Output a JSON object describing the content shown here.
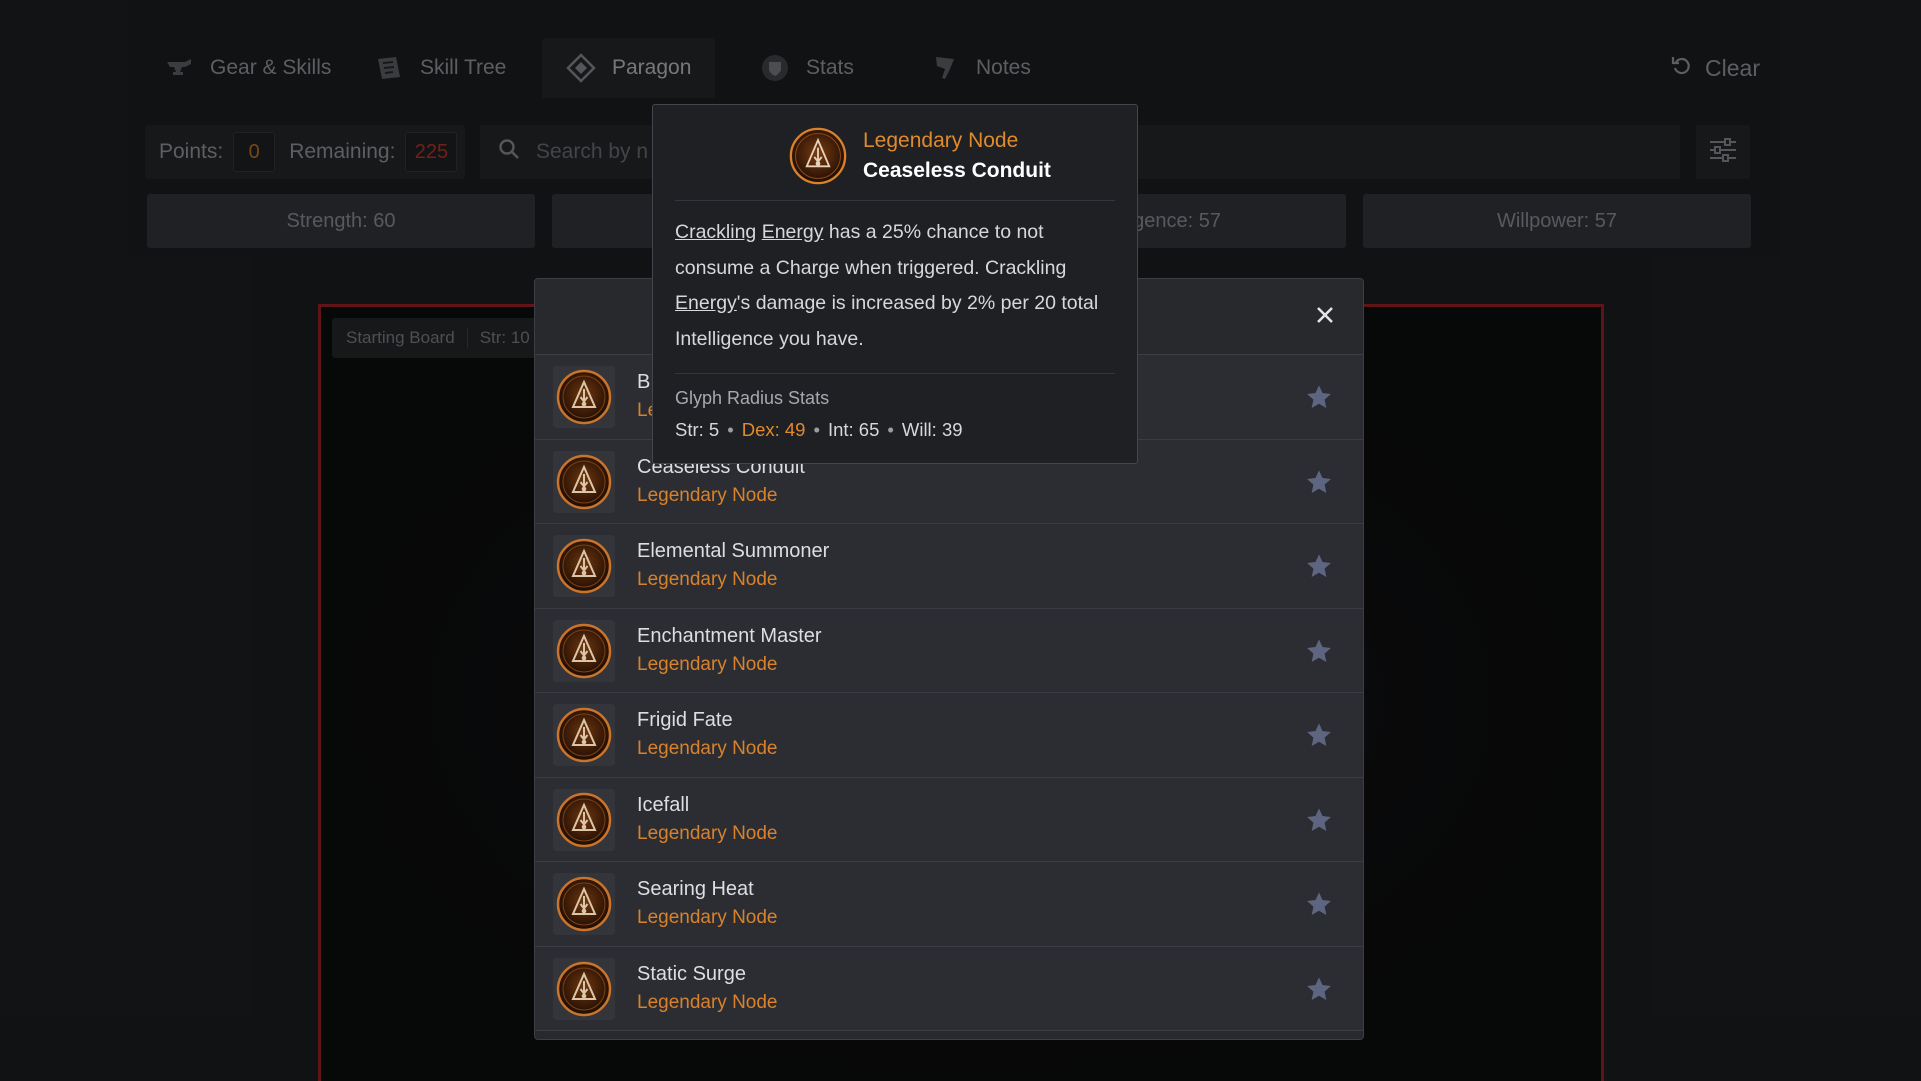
{
  "nav": {
    "tabs": [
      {
        "label": "Gear & Skills",
        "icon": "anvil-icon"
      },
      {
        "label": "Skill Tree",
        "icon": "skill-tree-icon"
      },
      {
        "label": "Paragon",
        "icon": "paragon-diamond-icon",
        "active": true
      },
      {
        "label": "Stats",
        "icon": "shield-stats-icon"
      },
      {
        "label": "Notes",
        "icon": "notes-quill-icon"
      }
    ],
    "clear_label": "Clear"
  },
  "toolbar": {
    "points_label": "Points:",
    "points_value": "0",
    "remaining_label": "Remaining:",
    "remaining_value": "225",
    "search_placeholder": "Search by n"
  },
  "attributes": {
    "strength": "Strength: 60",
    "intelligence": "gence: 57",
    "willpower": "Willpower: 57"
  },
  "board": {
    "name": "Starting Board",
    "str": "Str: 10"
  },
  "modal": {
    "rows": [
      {
        "name": "B",
        "type": "Le"
      },
      {
        "name": "Ceaseless Conduit",
        "type": "Legendary Node"
      },
      {
        "name": "Elemental Summoner",
        "type": "Legendary Node"
      },
      {
        "name": "Enchantment Master",
        "type": "Legendary Node"
      },
      {
        "name": "Frigid Fate",
        "type": "Legendary Node"
      },
      {
        "name": "Icefall",
        "type": "Legendary Node"
      },
      {
        "name": "Searing Heat",
        "type": "Legendary Node"
      },
      {
        "name": "Static Surge",
        "type": "Legendary Node"
      }
    ]
  },
  "tooltip": {
    "kind": "Legendary Node",
    "name": "Ceaseless Conduit",
    "desc_link1": "Crackling",
    "desc_link2": "Energy",
    "desc_part1": " has a 25% chance to not consume a Charge when triggered. Crackling ",
    "desc_link3": "Energy",
    "desc_part2": "'s damage is increased by 2% per 20 total Intelligence you have.",
    "radius_title": "Glyph Radius Stats",
    "str": "Str: 5",
    "dex": "Dex: 49",
    "int": "Int: 65",
    "will": "Will: 39",
    "separator": "•"
  },
  "colors": {
    "accent_orange": "#d9822b",
    "remaining_red": "#d23b2e",
    "board_border": "#b0252a",
    "star": "#5e6580"
  }
}
